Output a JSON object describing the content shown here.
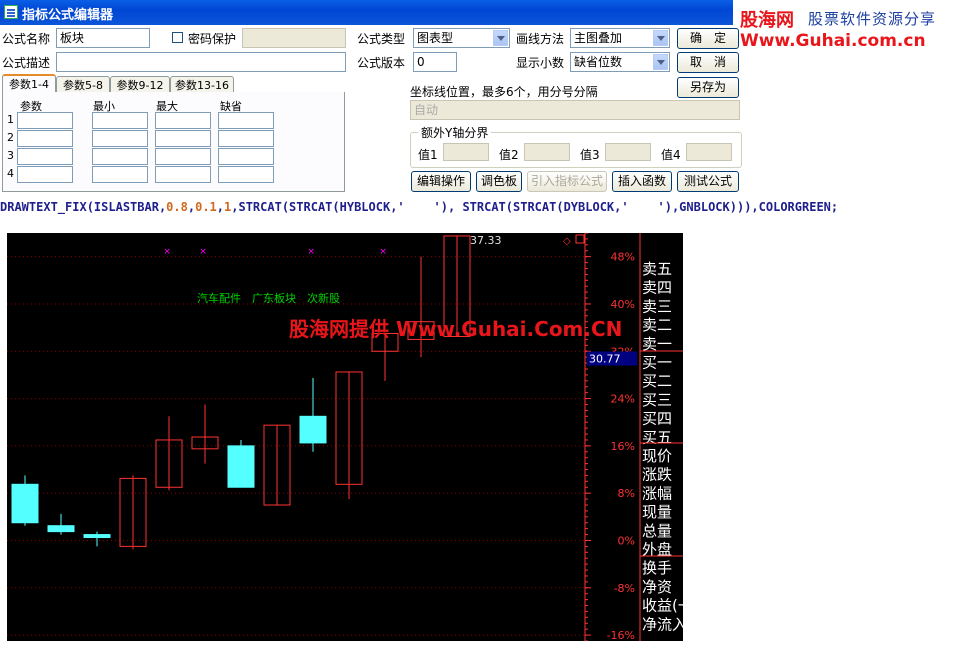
{
  "window": {
    "title": "指标公式编辑器"
  },
  "watermark": {
    "brand": "股海网",
    "slogan": "股票软件资源分享",
    "url": "Www.Guhai.com.cn"
  },
  "form": {
    "name_label": "公式名称",
    "name_value": "板块",
    "password_label": "密码保护",
    "password_checked": false,
    "desc_label": "公式描述",
    "desc_value": "",
    "type_label": "公式类型",
    "type_value": "图表型",
    "draw_label": "画线方法",
    "draw_value": "主图叠加",
    "version_label": "公式版本",
    "version_value": "0",
    "decimal_label": "显示小数",
    "decimal_value": "缺省位数",
    "confirm_label": "确　定",
    "cancel_label": "取　消",
    "saveas_label": "另存为",
    "axis_pos_label": "坐标线位置，最多6个，用分号分隔",
    "axis_pos_value": "自动",
    "extra_y_label": "额外Y轴分界",
    "val_labels": [
      "值1",
      "值2",
      "值3",
      "值4"
    ]
  },
  "param_tabs": [
    "参数1-4",
    "参数5-8",
    "参数9-12",
    "参数13-16"
  ],
  "param_headers": [
    "参数",
    "最小",
    "最大",
    "缺省"
  ],
  "param_rows": [
    "1",
    "2",
    "3",
    "4"
  ],
  "actions": {
    "edit": "编辑操作",
    "palette": "调色板",
    "import": "引入指标公式",
    "insert_fn": "插入函数",
    "test": "测试公式"
  },
  "formula": {
    "p1": "DRAWTEXT_FIX(ISLASTBAR,",
    "n1": "0.8",
    "c1": ",",
    "n2": "0.1",
    "c2": ",",
    "n3": "1",
    "p2": ",STRCAT(STRCAT(HYBLOCK,'    '), STRCAT(STRCAT(DYBLOCK,'    '),GNBLOCK))),COLORGREEN;"
  },
  "chart_data": {
    "type": "candlestick",
    "overlay_text": "汽车配件　广东板块　次新股",
    "overlay_watermark": "股海网提供 Www.Guhai.Com.CN",
    "ylim": [
      -17,
      52
    ],
    "y_ticks": [
      "48%",
      "40%",
      "32%",
      "24%",
      "16%",
      "8%",
      "0%",
      "-8%",
      "-16%"
    ],
    "y_tick_values": [
      48,
      40,
      32,
      24,
      16,
      8,
      0,
      -8,
      -16
    ],
    "current_label": "30.77",
    "current_value": 30.77,
    "max_label": "37.33",
    "candles": [
      {
        "o": 3,
        "c": 9.5,
        "h": 11,
        "l": 2.5,
        "up": false
      },
      {
        "o": 1.5,
        "c": 2.5,
        "h": 4.5,
        "l": 1,
        "up": false
      },
      {
        "o": 0.5,
        "c": 1,
        "h": 1.5,
        "l": -1,
        "up": false
      },
      {
        "o": -1,
        "c": 10.5,
        "h": 11,
        "l": -1.5,
        "up": true
      },
      {
        "o": 9,
        "c": 17,
        "h": 21,
        "l": 8.5,
        "up": true
      },
      {
        "o": 15.5,
        "c": 17.5,
        "h": 23,
        "l": 13,
        "up": true
      },
      {
        "o": 9,
        "c": 16,
        "h": 17,
        "l": 9,
        "up": false
      },
      {
        "o": 6,
        "c": 19.5,
        "h": 19.5,
        "l": 6,
        "up": true
      },
      {
        "o": 16.5,
        "c": 21,
        "h": 27.5,
        "l": 15,
        "up": false
      },
      {
        "o": 9.5,
        "c": 28.5,
        "h": 28.5,
        "l": 7,
        "up": true
      },
      {
        "o": 32,
        "c": 35,
        "h": 35,
        "l": 27,
        "up": true
      },
      {
        "o": 34,
        "c": 37,
        "h": 48,
        "l": 31,
        "up": true
      },
      {
        "o": 34.5,
        "c": 51.5,
        "h": 51.5,
        "l": 34.5,
        "up": true
      }
    ],
    "markers_x_index": [
      4.4,
      5.4,
      8.4,
      10.4
    ],
    "grid": true
  },
  "quote_labels": [
    "卖五",
    "卖四",
    "卖三",
    "卖二",
    "卖一",
    "买一",
    "买二",
    "买三",
    "买四",
    "买五",
    "现价",
    "涨跌",
    "涨幅",
    "现量",
    "总量",
    "外盘",
    "换手",
    "净资",
    "收益(一",
    "净流入"
  ],
  "colors": {
    "up": "#ff3232",
    "down": "#54ffff",
    "grid": "#8b0000",
    "axis_text": "#ff3232",
    "overlay_text": "#00d200",
    "watermark": "#e8151a",
    "price_box": "#000080"
  }
}
